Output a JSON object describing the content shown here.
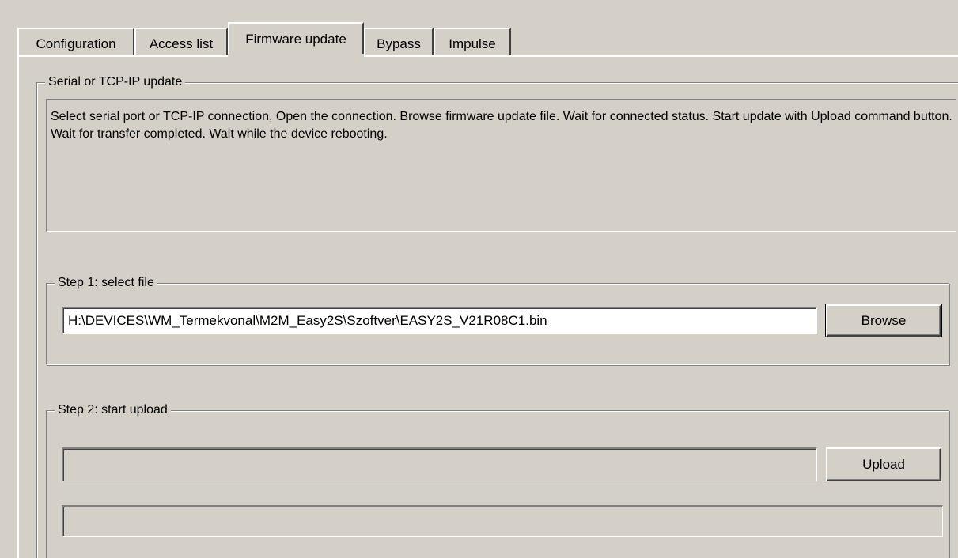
{
  "tabs": [
    {
      "label": "Configuration",
      "active": false
    },
    {
      "label": "Access list",
      "active": false
    },
    {
      "label": "Firmware update",
      "active": true
    },
    {
      "label": "Bypass",
      "active": false
    },
    {
      "label": "Impulse",
      "active": false
    }
  ],
  "serial_group": {
    "title": "Serial or TCP-IP update",
    "description": "Select serial port or TCP-IP connection,  Open the connection. Browse firmware update file. Wait for connected status. Start update with Upload command button. Wait for transfer completed. Wait while the device rebooting."
  },
  "step1": {
    "title": "Step 1: select file",
    "file_path": "H:\\DEVICES\\WM_Termekvonal\\M2M_Easy2S\\Szoftver\\EASY2S_V21R08C1.bin",
    "browse_label": "Browse"
  },
  "step2": {
    "title": "Step 2: start upload",
    "status_value": "",
    "upload_label": "Upload",
    "progress": 0
  }
}
